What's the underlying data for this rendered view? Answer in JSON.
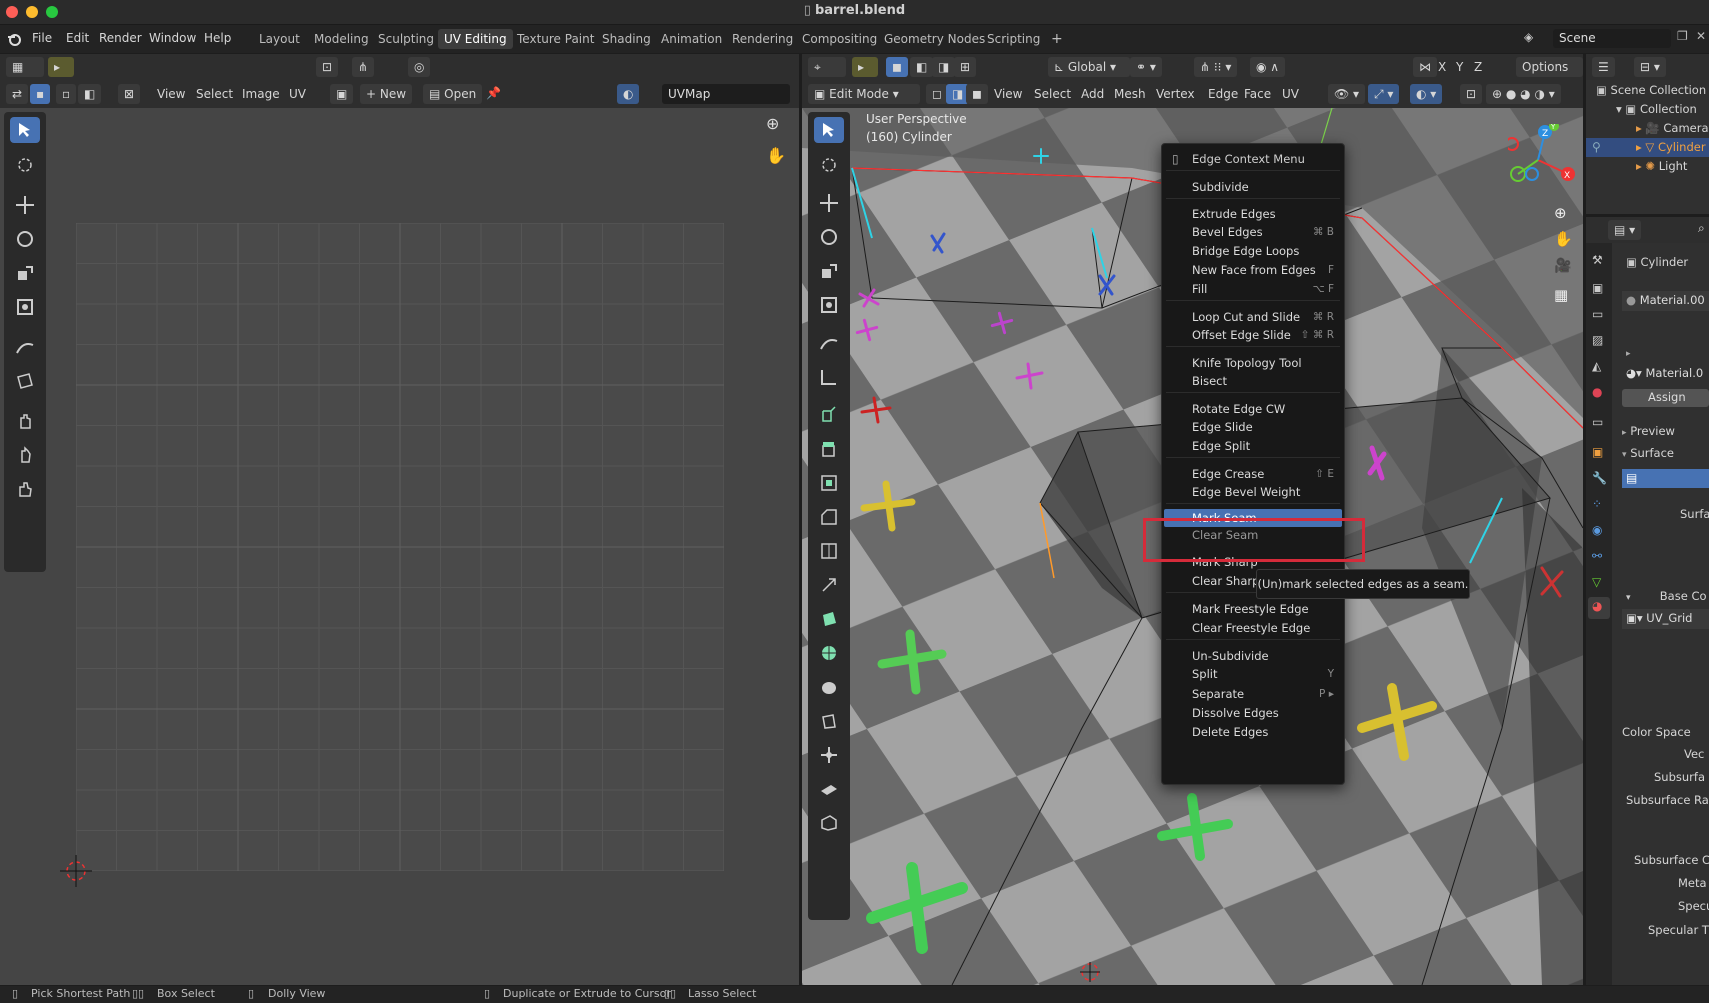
{
  "window": {
    "title": "barrel.blend"
  },
  "top_menu": [
    "File",
    "Edit",
    "Render",
    "Window",
    "Help"
  ],
  "workspace_tabs": [
    "Layout",
    "Modeling",
    "Sculpting",
    "UV Editing",
    "Texture Paint",
    "Shading",
    "Animation",
    "Rendering",
    "Compositing",
    "Geometry Nodes",
    "Scripting"
  ],
  "active_workspace": "UV Editing",
  "scene_name": "Scene",
  "uv_editor": {
    "menus": [
      "View",
      "Select",
      "Image",
      "UV"
    ],
    "new_label": "New",
    "open_label": "Open",
    "uvmap_name": "UVMap"
  },
  "viewport": {
    "mode": "Edit Mode",
    "menus": [
      "View",
      "Select",
      "Add",
      "Mesh",
      "Vertex",
      "Edge",
      "Face",
      "UV"
    ],
    "orientation": "Global",
    "options_label": "Options",
    "perspective_label": "User Perspective",
    "object_label": "(160) Cylinder",
    "axis_labels": {
      "x": "X",
      "y": "Y",
      "z": "Z"
    }
  },
  "context_menu": {
    "title": "Edge Context Menu",
    "highlighted": "Mark Seam",
    "items": [
      {
        "label": "Subdivide",
        "key": ""
      },
      {
        "label": "Extrude Edges",
        "key": ""
      },
      {
        "label": "Bevel Edges",
        "key": "⌘ B"
      },
      {
        "label": "Bridge Edge Loops",
        "key": ""
      },
      {
        "label": "New Face from Edges",
        "key": "F"
      },
      {
        "label": "Fill",
        "key": "⌥ F"
      },
      {
        "label": "Loop Cut and Slide",
        "key": "⌘ R"
      },
      {
        "label": "Offset Edge Slide",
        "key": "⇧ ⌘ R"
      },
      {
        "label": "Knife Topology Tool",
        "key": ""
      },
      {
        "label": "Bisect",
        "key": ""
      },
      {
        "label": "Rotate Edge CW",
        "key": ""
      },
      {
        "label": "Edge Slide",
        "key": ""
      },
      {
        "label": "Edge Split",
        "key": ""
      },
      {
        "label": "Edge Crease",
        "key": "⇧ E"
      },
      {
        "label": "Edge Bevel Weight",
        "key": ""
      },
      {
        "label": "Mark Seam",
        "key": ""
      },
      {
        "label": "Clear Seam",
        "key": ""
      },
      {
        "label": "Mark Sharp",
        "key": ""
      },
      {
        "label": "Clear Sharp",
        "key": ""
      },
      {
        "label": "Mark Freestyle Edge",
        "key": ""
      },
      {
        "label": "Clear Freestyle Edge",
        "key": ""
      },
      {
        "label": "Un-Subdivide",
        "key": ""
      },
      {
        "label": "Split",
        "key": "Y"
      },
      {
        "label": "Separate",
        "key": "P ▸"
      },
      {
        "label": "Dissolve Edges",
        "key": ""
      },
      {
        "label": "Delete Edges",
        "key": ""
      }
    ],
    "tooltip": "(Un)mark selected edges as a seam."
  },
  "outliner": {
    "items": [
      "Scene Collection",
      "Collection",
      "Camera",
      "Cylinder",
      "Light"
    ]
  },
  "properties": {
    "object_name": "Cylinder",
    "material_slot": "Material.00",
    "material_name": "Material.0",
    "assign_label": "Assign",
    "preview_label": "Preview",
    "surface_label": "Surface",
    "surface_field": "Surfa",
    "base_color_label": "Base Co",
    "image_name": "UV_Grid",
    "fields": [
      "Color Space",
      "Vec",
      "Subsurfa",
      "Subsurface Rad",
      "Subsurface Co",
      "Meta",
      "Specu",
      "Specular T"
    ]
  },
  "status_bar": [
    "Pick Shortest Path",
    "Box Select",
    "Dolly View",
    "Duplicate or Extrude to Cursor",
    "Lasso Select"
  ],
  "colors": {
    "accent": "#4772b3",
    "highlight_box": "#d52b3a",
    "seam": "#2fd3e6"
  }
}
